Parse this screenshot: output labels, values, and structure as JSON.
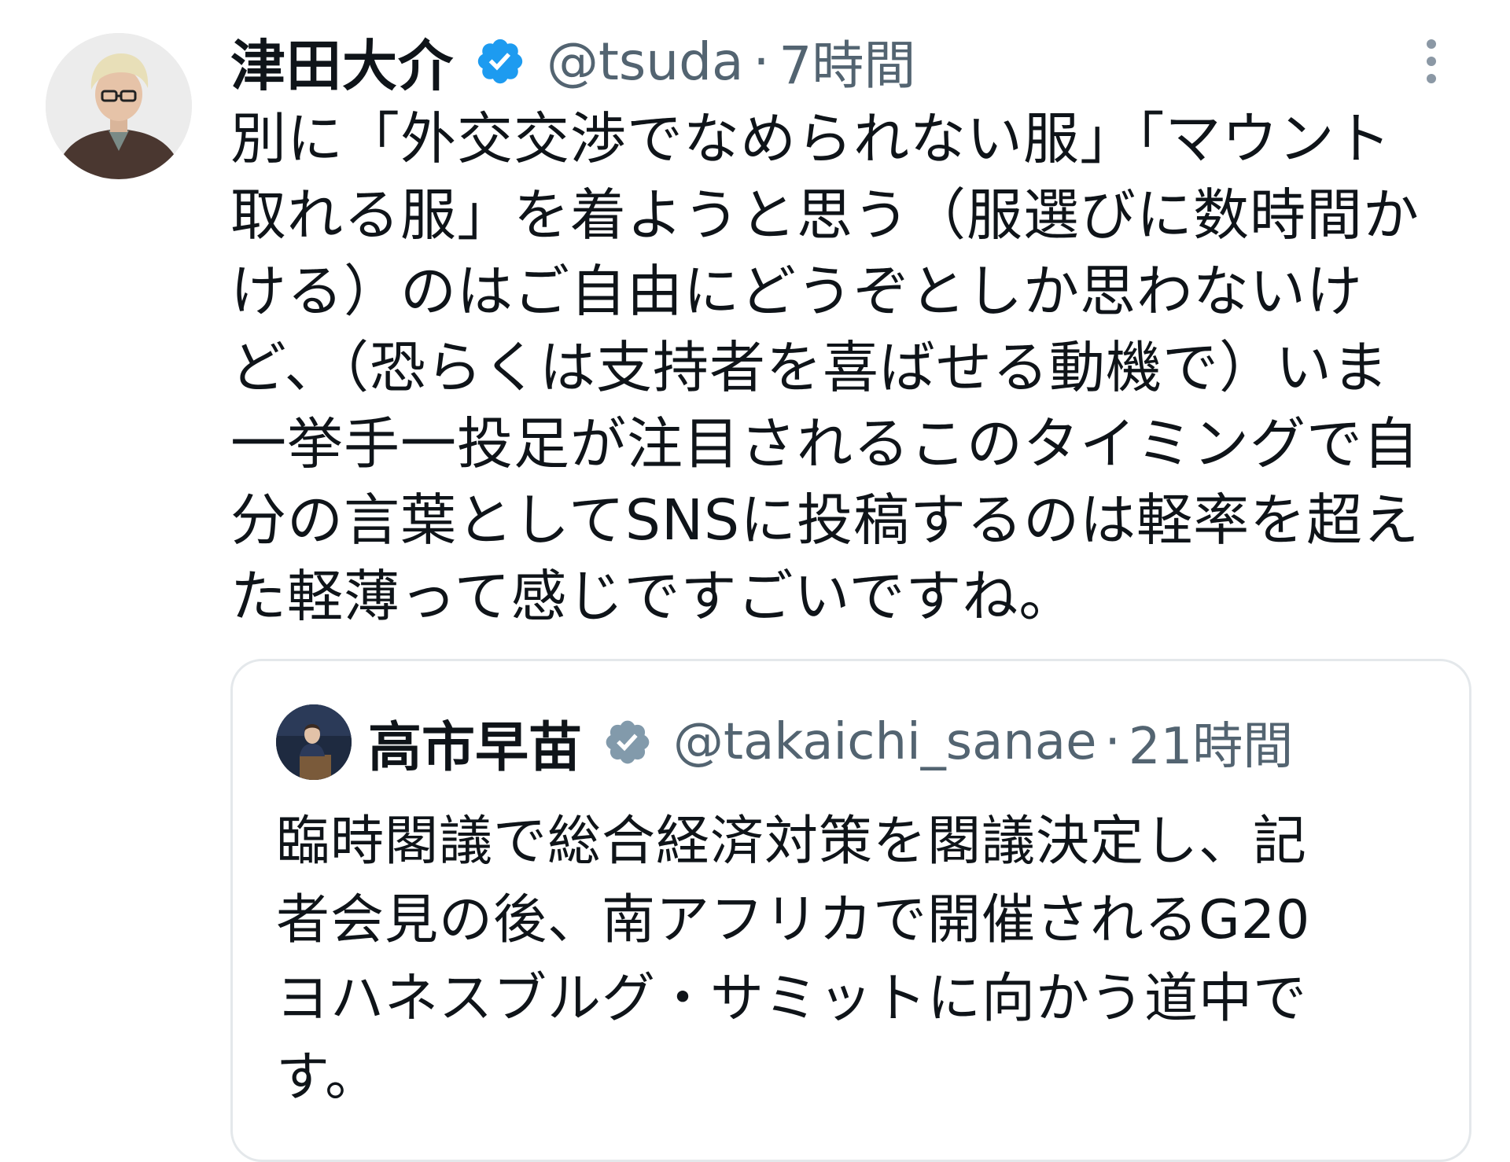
{
  "tweet": {
    "display_name": "津田大介",
    "handle": "@tsuda",
    "separator": "·",
    "time": "7時間",
    "verified_badge": "blue-check-icon",
    "body_lines": [
      "別に「外交交渉でなめられない服」「マウント",
      "取れる服」を着ようと思う（服選びに数時間か",
      "ける）のはご自由にどうぞとしか思わないけ",
      "ど、（恐らくは支持者を喜ばせる動機で）いま",
      "一挙手一投足が注目されるこのタイミングで自",
      "分の言葉としてSNSに投稿するのは軽率を超え",
      "た軽薄って感じですごいですね。"
    ]
  },
  "quoted_tweet": {
    "display_name": "高市早苗",
    "handle": "@takaichi_sanae",
    "separator": "·",
    "time": "21時間",
    "verified_badge": "gray-check-icon",
    "body_lines": [
      "臨時閣議で総合経済対策を閣議決定し、記",
      "者会見の後、南アフリカで開催されるG20",
      "ヨハネスブルグ・サミットに向かう道中で",
      "す。"
    ]
  },
  "colors": {
    "text_primary": "#0f1419",
    "text_secondary": "#536471",
    "verified_blue": "#1d9bf0",
    "verified_gray": "#829aab",
    "border": "#e4e8eb"
  }
}
